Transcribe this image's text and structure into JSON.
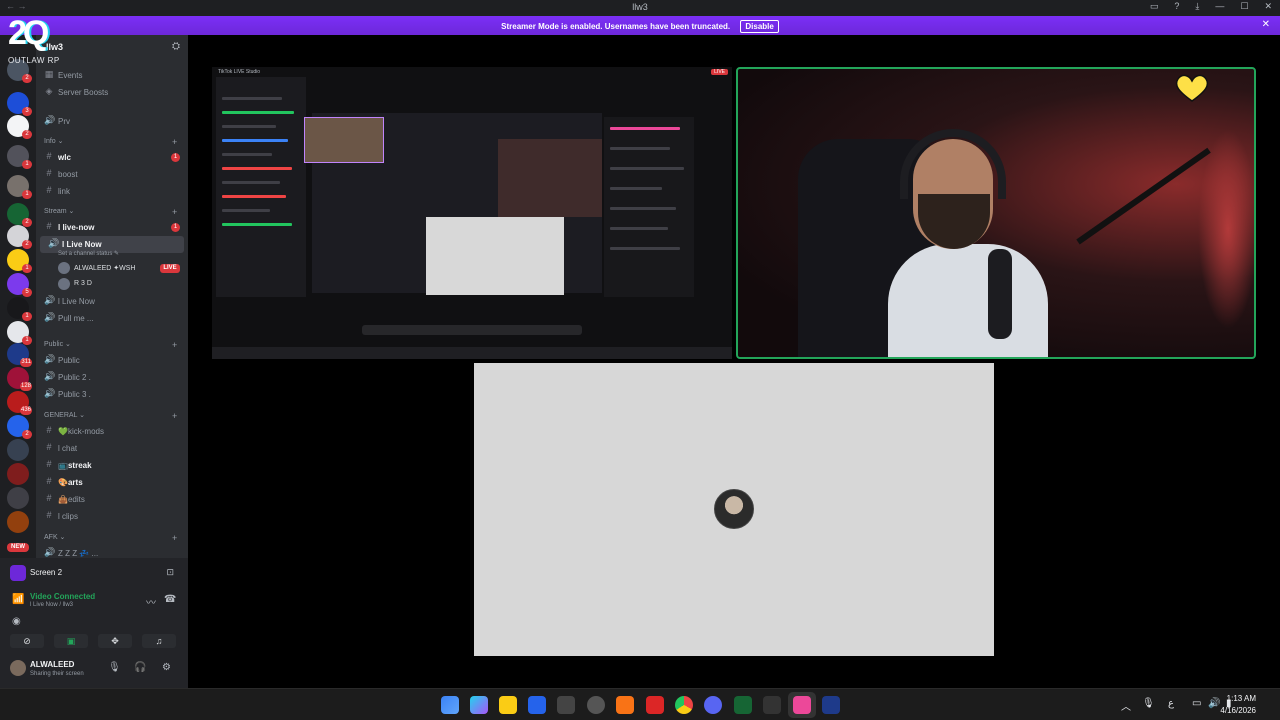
{
  "window": {
    "title": "llw3",
    "nav": "←  →"
  },
  "streamer_banner": {
    "message": "Streamer Mode is enabled. Usernames have been truncated.",
    "disable_label": "Disable"
  },
  "logo": {
    "text": "OUTLAW RP",
    "glyph": "2Q"
  },
  "server": {
    "name": "llw3"
  },
  "guild_badges": [
    "2",
    "3",
    "2",
    "1",
    "1",
    "2",
    "2",
    "1",
    "5",
    "1",
    "1",
    "311",
    "128",
    "436",
    "2"
  ],
  "new_label": "NEW",
  "channels": {
    "top": [
      {
        "icon": "calendar-icon",
        "label": "Events"
      },
      {
        "icon": "boost-icon",
        "label": "Server Boosts"
      },
      {
        "icon": "speaker-icon",
        "label": "Prv"
      }
    ],
    "categories": [
      {
        "name": "Info",
        "items": [
          {
            "icon": "#",
            "label": "wlc",
            "bright": true,
            "badge": "1"
          },
          {
            "icon": "#",
            "label": "boost"
          },
          {
            "icon": "#",
            "label": "link"
          }
        ]
      },
      {
        "name": "Stream",
        "items": [
          {
            "icon": "#",
            "label": "l live-now",
            "bright": true,
            "badge": "1"
          },
          {
            "icon": "speaker",
            "label": "l Live Now",
            "bright": true,
            "active": true,
            "sub": "Set a channel status ✎",
            "users": [
              {
                "name": "ALWALEED",
                "tag": "WSH",
                "live": "LIVE"
              },
              {
                "name": "R 3 D"
              }
            ]
          },
          {
            "icon": "speaker",
            "label": "l Live Now"
          },
          {
            "icon": "speaker",
            "label": "Pull me ..."
          }
        ]
      },
      {
        "name": "Public",
        "items": [
          {
            "icon": "speaker",
            "label": "Public"
          },
          {
            "icon": "speaker",
            "label": "Public 2 ."
          },
          {
            "icon": "speaker",
            "label": "Public 3 ."
          }
        ]
      },
      {
        "name": "GENERAL",
        "items": [
          {
            "icon": "#",
            "label": "💚kick-mods"
          },
          {
            "icon": "#",
            "label": "l chat"
          },
          {
            "icon": "#",
            "label": "📺streak",
            "bright": true
          },
          {
            "icon": "#",
            "label": "🎨arts",
            "bright": true
          },
          {
            "icon": "#",
            "label": "👜edits"
          },
          {
            "icon": "#",
            "label": "l clips"
          }
        ]
      },
      {
        "name": "AFK",
        "items": [
          {
            "icon": "speaker",
            "label": "Z Z Z 💤 ..."
          }
        ]
      }
    ]
  },
  "screen_share": {
    "label": "Screen 2"
  },
  "voice": {
    "status": "Video Connected",
    "location": "l Live Now / llw3"
  },
  "account": {
    "name": "ALWALEED",
    "status": "Sharing their screen"
  },
  "stream_preview": {
    "app_title": "TikTok LIVE Studio",
    "live_label": "LIVE"
  },
  "clock": {
    "time": "1:13 AM",
    "date": "4/16/2026"
  },
  "colors": {
    "accent": "#5865f2",
    "banner": "#6d28d9",
    "live": "#da373c",
    "connected": "#23a55a"
  }
}
